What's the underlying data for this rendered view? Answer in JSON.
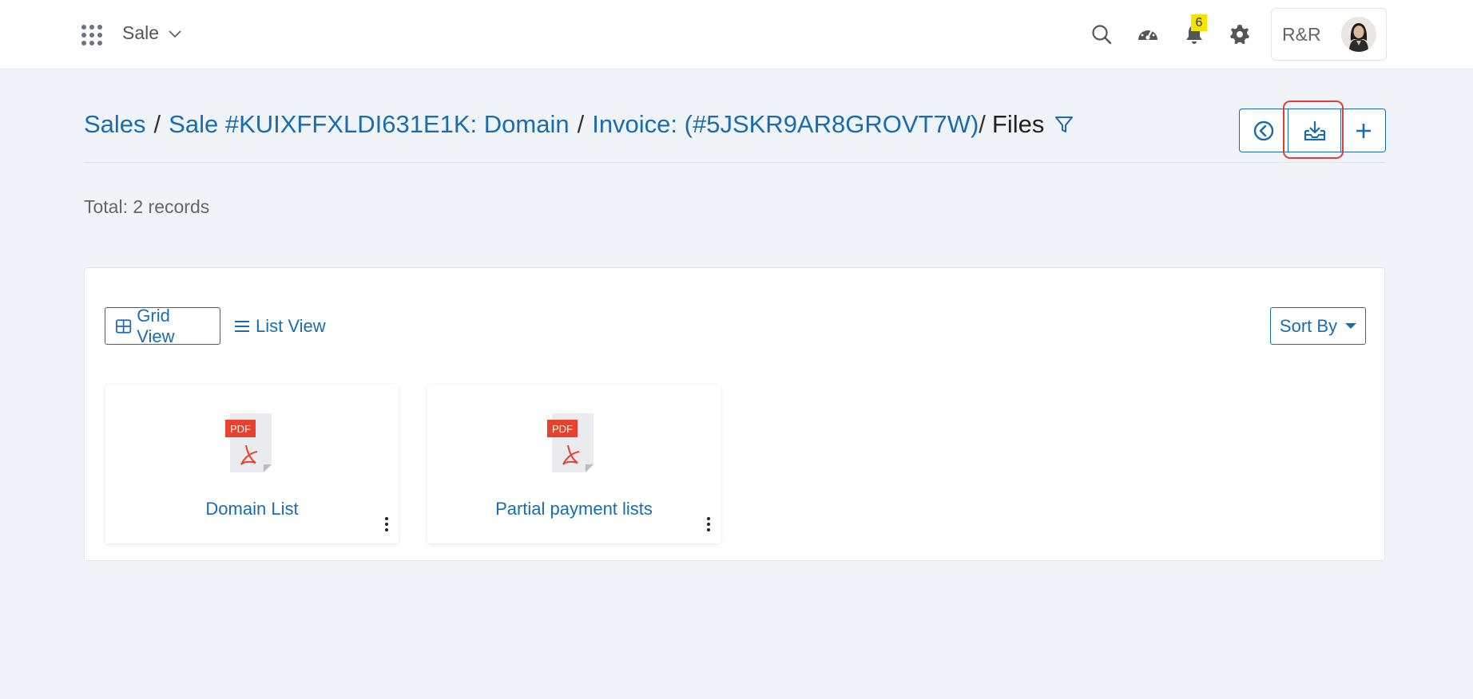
{
  "topbar": {
    "app_name": "Sale",
    "notification_count": "6",
    "user_name": "R&R",
    "icons": [
      "apps-grid-icon",
      "chevron-down-icon",
      "search-icon",
      "dashboard-gauge-icon",
      "bell-icon",
      "gear-icon"
    ]
  },
  "breadcrumb": {
    "sales": "Sales",
    "sale": "Sale #KUIXFFXLDI631E1K: Domain",
    "invoice": "Invoice: (#5JSKR9AR8GROVT7W)",
    "current": "Files"
  },
  "actions": {
    "icons": [
      "back-circle-icon",
      "download-tray-icon",
      "plus-icon"
    ]
  },
  "summary": {
    "total": "Total: 2 records"
  },
  "view": {
    "grid_label": "Grid View",
    "list_label": "List View",
    "sort_label": "Sort By"
  },
  "files": [
    {
      "name": "Domain List",
      "type_label": "PDF"
    },
    {
      "name": "Partial payment lists",
      "type_label": "PDF"
    }
  ],
  "colors": {
    "accent": "#1a6cb0",
    "background": "#f0f3f7",
    "highlight": "#e23b3b",
    "badge": "#f5e400",
    "pdf_red": "#e8422f"
  }
}
